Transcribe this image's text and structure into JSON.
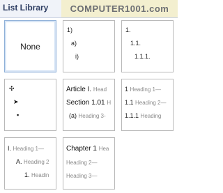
{
  "header": {
    "title": "List Library",
    "watermark": "COMPUTER1001.com"
  },
  "tiles": {
    "none": {
      "label": "None"
    },
    "t2": {
      "rows": [
        "1)",
        "a)",
        "i)"
      ]
    },
    "t3": {
      "rows": [
        "1.",
        "1.1.",
        "1.1.1."
      ]
    },
    "t4": {
      "rows": [
        "✣",
        "➤",
        "▪"
      ]
    },
    "t5": {
      "rows": [
        {
          "num": "Article I.",
          "text": "Head"
        },
        {
          "num": "Section 1.01",
          "text": "H"
        },
        {
          "num": "(a)",
          "text": "Heading 3-"
        }
      ]
    },
    "t6": {
      "rows": [
        {
          "num": "1",
          "text": "Heading 1—"
        },
        {
          "num": "1.1",
          "text": "Heading 2—"
        },
        {
          "num": "1.1.1",
          "text": "Heading"
        }
      ]
    },
    "t7": {
      "rows": [
        {
          "num": "I.",
          "text": "Heading 1—"
        },
        {
          "num": "A.",
          "text": "Heading 2"
        },
        {
          "num": "1.",
          "text": "Headin"
        }
      ]
    },
    "t8": {
      "rows": [
        {
          "num": "Chapter 1",
          "text": "Hea"
        },
        {
          "num": "",
          "text": "Heading 2—"
        },
        {
          "num": "",
          "text": "Heading 3—"
        }
      ]
    }
  }
}
